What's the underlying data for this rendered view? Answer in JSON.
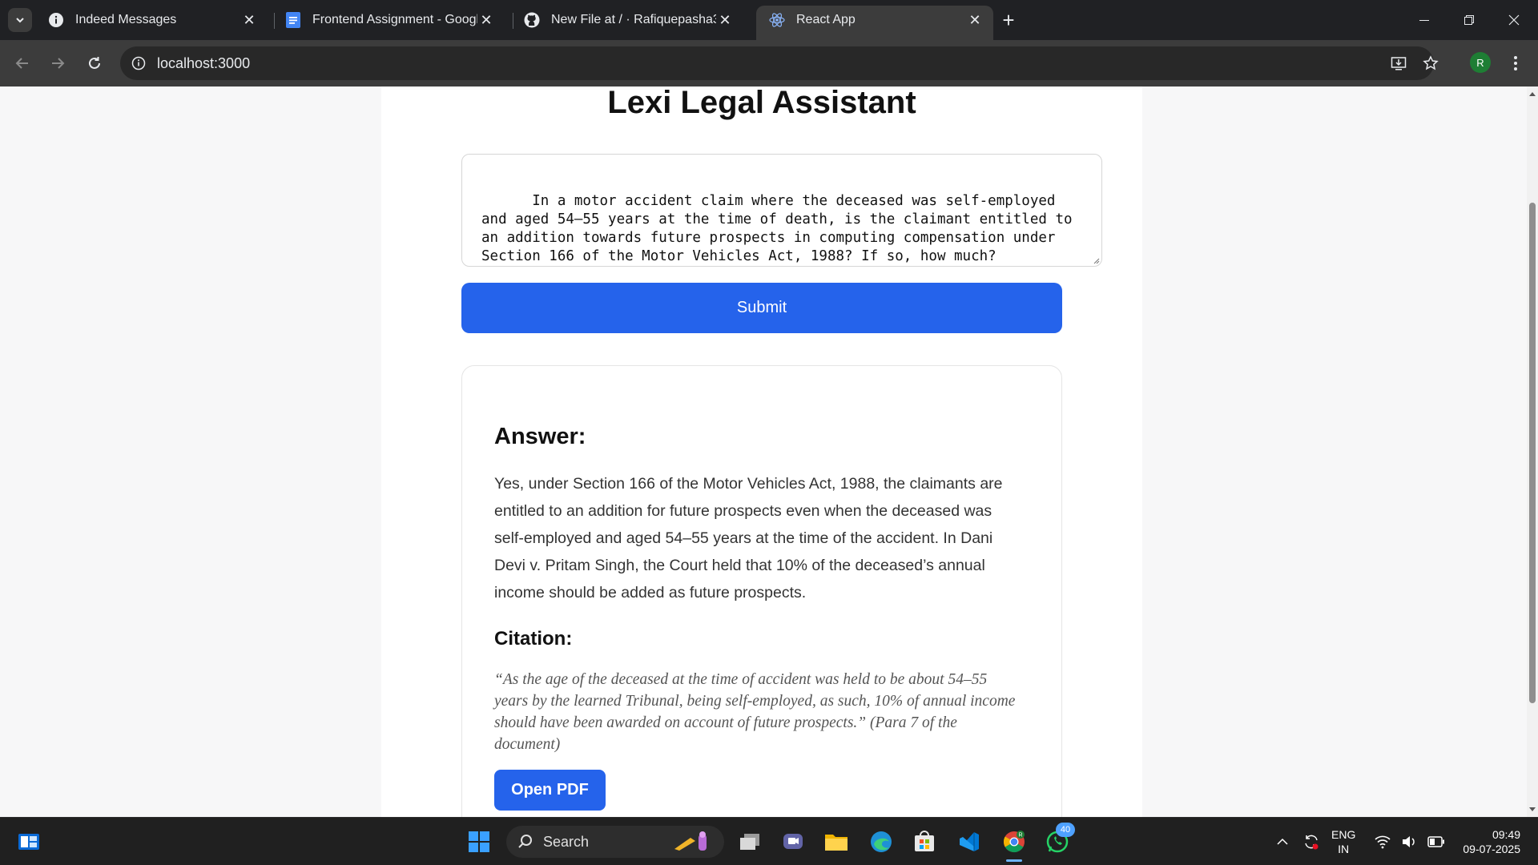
{
  "browser": {
    "tabs": [
      {
        "title": "Indeed Messages",
        "icon": "info-icon"
      },
      {
        "title": "Frontend Assignment - Google",
        "icon": "google-docs-icon"
      },
      {
        "title": "New File at / · Rafiquepasha30/",
        "icon": "github-icon"
      },
      {
        "title": "React App",
        "icon": "react-icon",
        "active": true
      }
    ],
    "url": "localhost:3000",
    "profile_initial": "R"
  },
  "page": {
    "title": "Lexi Legal Assistant",
    "question": "In a motor accident claim where the deceased was self-employed and aged 54–55 years at the time of death, is the claimant entitled to an addition towards future prospects in computing compensation under Section 166 of the Motor Vehicles Act, 1988? If so, how much?",
    "submit_label": "Submit",
    "answer_heading": "Answer:",
    "answer_text": "Yes, under Section 166 of the Motor Vehicles Act, 1988, the claimants are entitled to an addition for future prospects even when the deceased was self-employed and aged 54–55 years at the time of the accident. In Dani Devi v. Pritam Singh, the Court held that 10% of the deceased’s annual income should be added as future prospects.",
    "citation_heading": "Citation:",
    "citation_text": "“As the age of the deceased at the time of accident was held to be about 54–55 years by the learned Tribunal, being self-employed, as such, 10% of annual income should have been awarded on account of future prospects.” (Para 7 of the document)",
    "pdf_button_label": "Open PDF"
  },
  "taskbar": {
    "search_label": "Search",
    "whatsapp_badge": "40",
    "language": "ENG",
    "region": "IN",
    "time": "09:49",
    "date": "09-07-2025"
  },
  "colors": {
    "accent": "#2563eb",
    "tabstrip": "#202124",
    "toolbar": "#3c3c3c"
  }
}
